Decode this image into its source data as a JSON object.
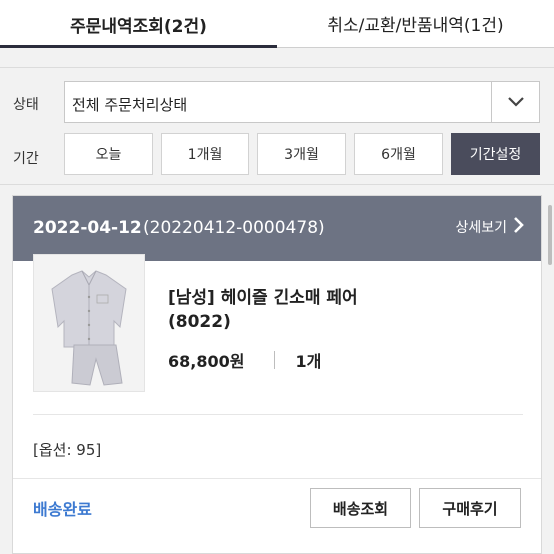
{
  "tabs": [
    {
      "label": "주문내역조회(2건)"
    },
    {
      "label": "취소/교환/반품내역(1건)"
    }
  ],
  "filter": {
    "status_label": "상태",
    "status_value": "전체 주문처리상태",
    "period_label": "기간",
    "period_buttons": [
      "오늘",
      "1개월",
      "3개월",
      "6개월",
      "기간설정"
    ]
  },
  "order": {
    "date": "2022-04-12",
    "number": "(20220412-0000478)",
    "detail_link": "상세보기",
    "product_name": "[남성] 헤이즐 긴소매 페어 (8022)",
    "price": "68,800원",
    "quantity": "1개",
    "option": "[옵션: 95]",
    "delivery_status": "배송완료",
    "track_button": "배송조회",
    "review_button": "구매후기"
  },
  "colors": {
    "header_bg": "#6d7383",
    "accent_blue": "#3d7ad1",
    "active_button": "#4a4c5c"
  }
}
